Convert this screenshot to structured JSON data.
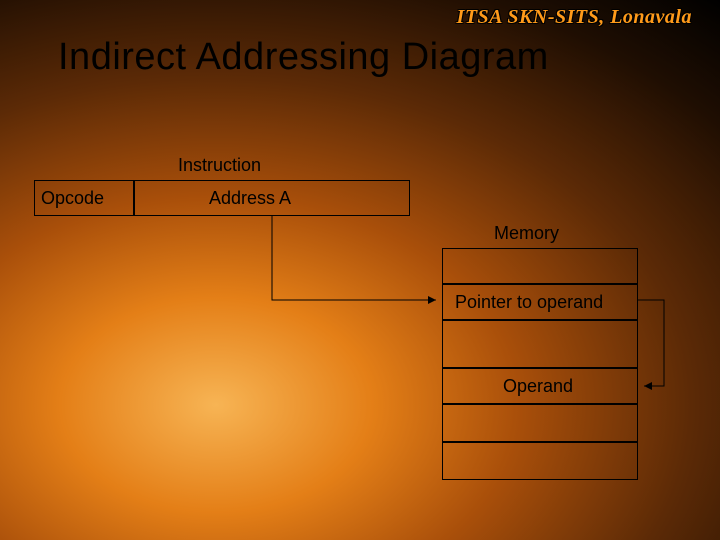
{
  "watermark": "ITSA SKN-SITS, Lonavala",
  "title": "Indirect Addressing Diagram",
  "labels": {
    "instruction": "Instruction",
    "memory": "Memory"
  },
  "boxes": {
    "opcode": "Opcode",
    "address": "Address A",
    "pointer": "Pointer to operand",
    "operand": "Operand"
  }
}
